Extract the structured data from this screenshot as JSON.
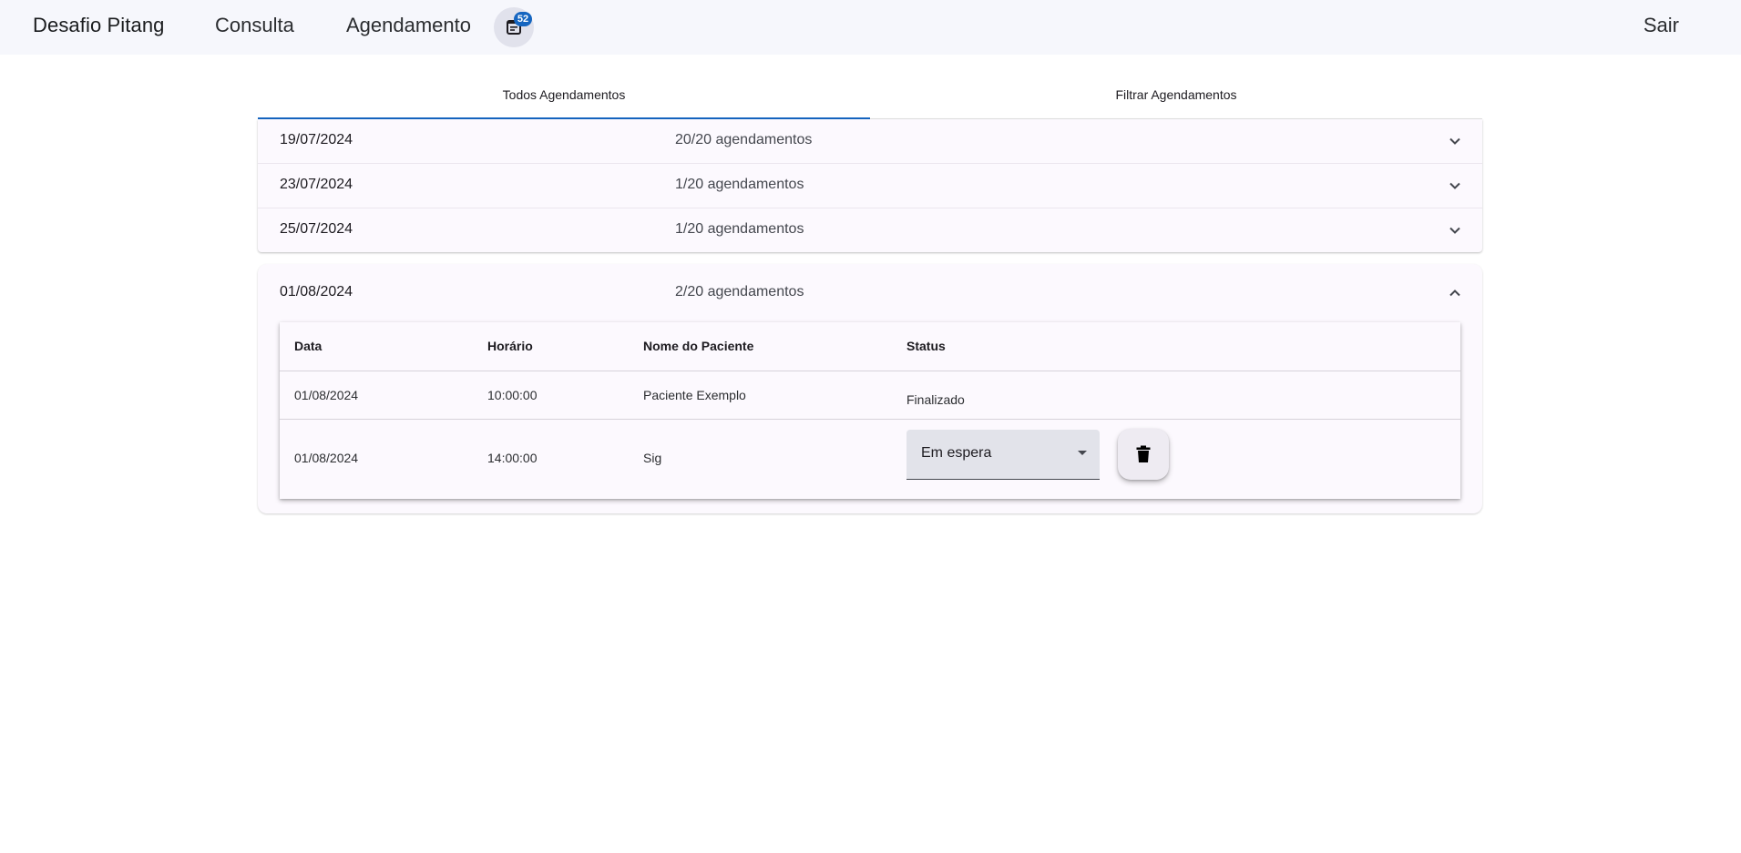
{
  "nav": {
    "brand": "Desafio Pitang",
    "links": [
      "Consulta",
      "Agendamento"
    ],
    "notification_icon": "calendar-list-icon",
    "badge_count": "52",
    "logout": "Sair"
  },
  "tabs": {
    "items": [
      "Todos Agendamentos",
      "Filtrar Agendamentos"
    ],
    "active_index": 0
  },
  "accordion": {
    "collapsed": [
      {
        "date": "19/07/2024",
        "count": "20/20 agendamentos"
      },
      {
        "date": "23/07/2024",
        "count": "1/20 agendamentos"
      },
      {
        "date": "25/07/2024",
        "count": "1/20 agendamentos"
      }
    ],
    "expanded": {
      "date": "01/08/2024",
      "count": "2/20 agendamentos"
    }
  },
  "table": {
    "headers": [
      "Data",
      "Horário",
      "Nome do Paciente",
      "Status"
    ],
    "rows": [
      {
        "data": "01/08/2024",
        "horario": "10:00:00",
        "paciente": "Paciente Exemplo",
        "status": "Finalizado"
      },
      {
        "data": "01/08/2024",
        "horario": "14:00:00",
        "paciente": "Sig",
        "status": "Em espera"
      }
    ],
    "delete_icon": "trash-icon"
  },
  "colors": {
    "accent": "#1565c0",
    "topbar_bg": "#f6f7fc",
    "panel_bg": "#fcf9fe"
  }
}
